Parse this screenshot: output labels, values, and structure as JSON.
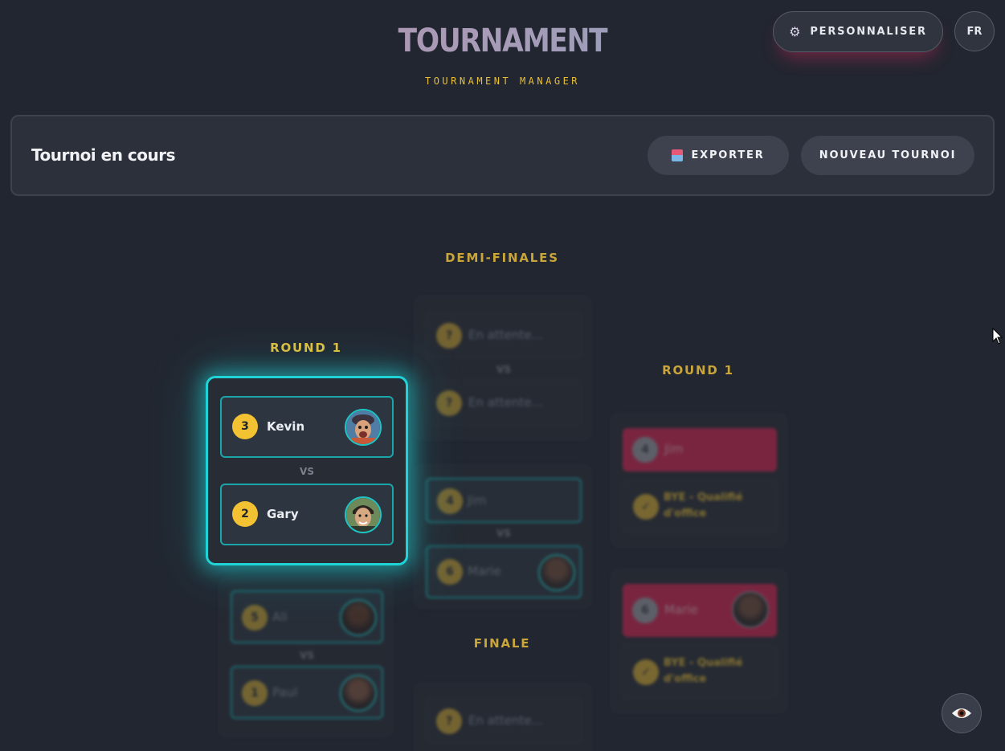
{
  "header": {
    "title": "TOURNAMENT",
    "subtitle": "TOURNAMENT MANAGER",
    "personalize_label": "PERSONNALISER",
    "language_label": "FR"
  },
  "toolbar": {
    "title": "Tournoi en cours",
    "export_label": "EXPORTER",
    "new_tournament_label": "NOUVEAU TOURNOI"
  },
  "bracket": {
    "semifinals_label": "DEMI-FINALES",
    "final_label": "FINALE",
    "left_round_label": "ROUND 1",
    "right_round_label": "ROUND 1",
    "vs_label": "VS",
    "focused_match": {
      "player1": {
        "seed": "3",
        "name": "Kevin"
      },
      "player2": {
        "seed": "2",
        "name": "Gary"
      }
    },
    "left_lower_match": {
      "player1": {
        "seed": "5",
        "name": "Ali"
      },
      "player2": {
        "seed": "1",
        "name": "Paul"
      }
    },
    "semifinal_top": {
      "player1": {
        "seed": "?",
        "name": "En attente..."
      },
      "player2": {
        "seed": "?",
        "name": "En attente..."
      }
    },
    "semifinal_bottom": {
      "player1": {
        "seed": "4",
        "name": "Jim"
      },
      "player2": {
        "seed": "6",
        "name": "Marie"
      }
    },
    "final_match": {
      "player1": {
        "seed": "?",
        "name": "En attente..."
      }
    },
    "right_top_match": {
      "player1": {
        "seed": "4",
        "name": "Jim"
      },
      "player2": {
        "seed": "✓",
        "name": "BYE - Qualifié d'office"
      }
    },
    "right_bottom_match": {
      "player1": {
        "seed": "6",
        "name": "Marie"
      },
      "player2": {
        "seed": "✓",
        "name": "BYE - Qualifié d'office"
      }
    }
  },
  "colors": {
    "accent_teal": "#1fd3d6",
    "gold": "#f2c233",
    "pink": "#c3264f",
    "background": "#222630"
  },
  "icons": {
    "personalize": "gear-icon",
    "export": "export-icon",
    "toggle_view": "eye-icon"
  }
}
